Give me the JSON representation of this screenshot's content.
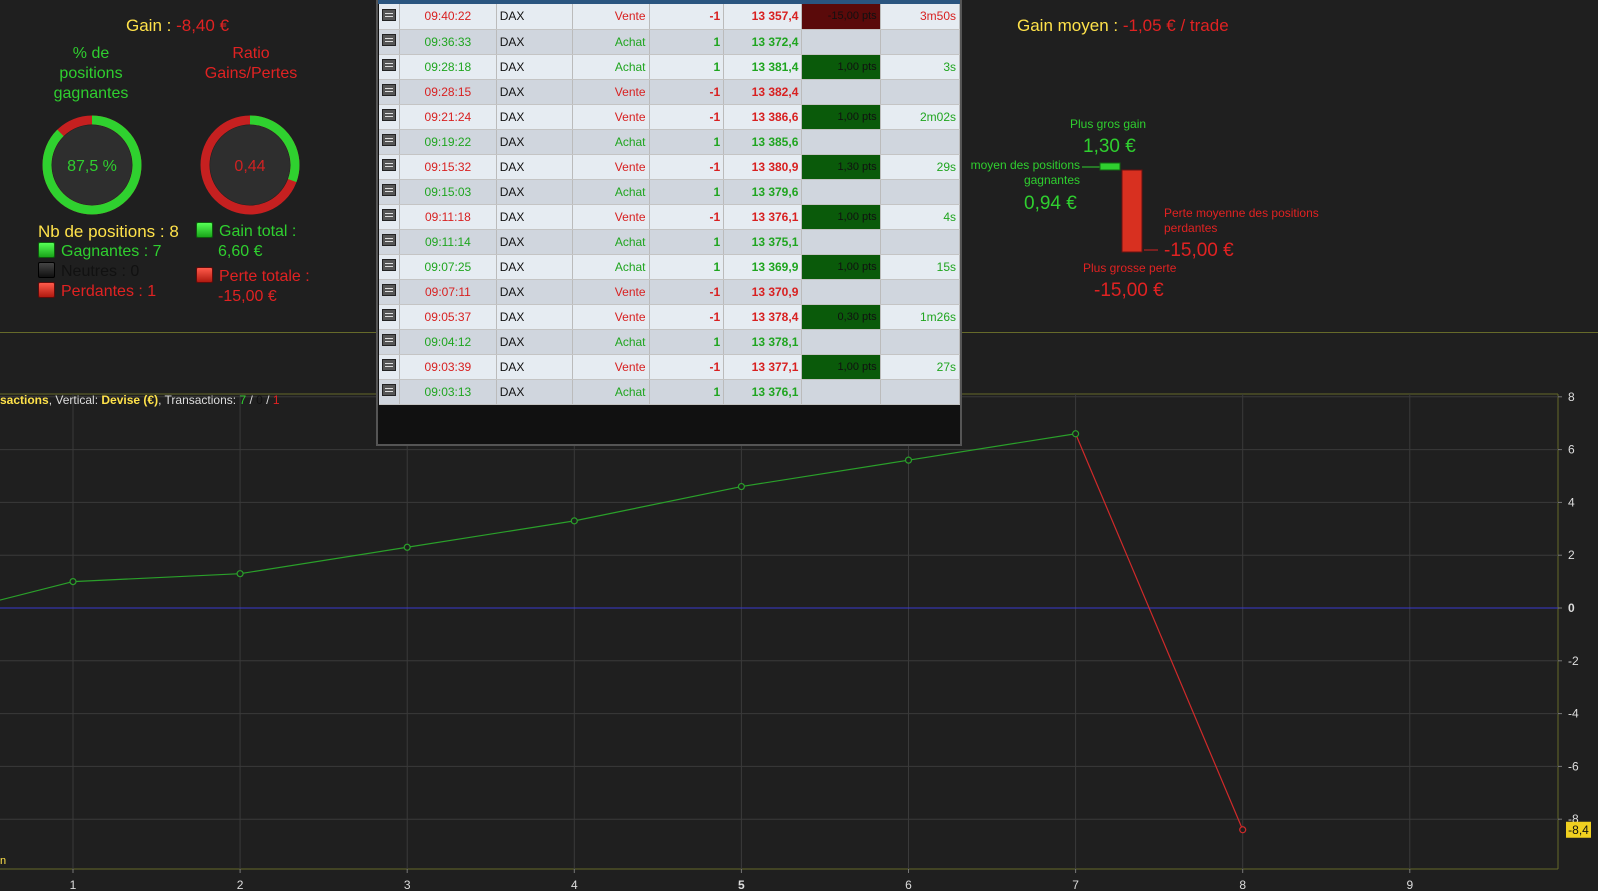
{
  "summary": {
    "gain_label": "Gain : ",
    "gain_value": "-8,40 €",
    "avg_gain_label": "Gain moyen : ",
    "avg_gain_value": "-1,05 € / trade",
    "win_pct_title": "% de positions gagnantes",
    "win_pct_value": "87,5 %",
    "win_pct": 87.5,
    "ratio_title": "Ratio Gains/Pertes",
    "ratio_value": "0,44",
    "ratio_fill": 0.306,
    "nb_positions": "Nb de positions : 8",
    "winners": "Gagnantes : 7",
    "neutral": "Neutres : 0",
    "losers": "Perdantes : 1",
    "total_gain_label": "Gain total :",
    "total_gain_value": "6,60 €",
    "total_loss_label": "Perte totale :",
    "total_loss_value": "-15,00 €"
  },
  "extremes": {
    "biggest_gain_label": "Plus gros gain",
    "biggest_gain_value": "1,30 €",
    "avg_win_label_1": "moyen des positions",
    "avg_win_label_2": "gagnantes",
    "avg_win_value": "0,94 €",
    "avg_loss_label_1": "Perte moyenne des positions",
    "avg_loss_label_2": "perdantes",
    "avg_loss_value": "-15,00 €",
    "biggest_loss_label": "Plus grosse perte",
    "biggest_loss_value": "-15,00 €"
  },
  "trades": [
    {
      "time": "09:40:22",
      "inst": "DAX",
      "side": "Vente",
      "qty": "-1",
      "price": "13 357,4",
      "pts": "-15,00 pts",
      "dur": "3m50s",
      "color": "red",
      "pts_color": "red"
    },
    {
      "time": "09:36:33",
      "inst": "DAX",
      "side": "Achat",
      "qty": "1",
      "price": "13 372,4",
      "pts": "",
      "dur": "",
      "color": "green",
      "pts_color": ""
    },
    {
      "time": "09:28:18",
      "inst": "DAX",
      "side": "Achat",
      "qty": "1",
      "price": "13 381,4",
      "pts": "1,00 pts",
      "dur": "3s",
      "color": "green",
      "pts_color": "green"
    },
    {
      "time": "09:28:15",
      "inst": "DAX",
      "side": "Vente",
      "qty": "-1",
      "price": "13 382,4",
      "pts": "",
      "dur": "",
      "color": "red",
      "pts_color": ""
    },
    {
      "time": "09:21:24",
      "inst": "DAX",
      "side": "Vente",
      "qty": "-1",
      "price": "13 386,6",
      "pts": "1,00 pts",
      "dur": "2m02s",
      "color": "red",
      "pts_color": "green"
    },
    {
      "time": "09:19:22",
      "inst": "DAX",
      "side": "Achat",
      "qty": "1",
      "price": "13 385,6",
      "pts": "",
      "dur": "",
      "color": "green",
      "pts_color": ""
    },
    {
      "time": "09:15:32",
      "inst": "DAX",
      "side": "Vente",
      "qty": "-1",
      "price": "13 380,9",
      "pts": "1,30 pts",
      "dur": "29s",
      "color": "red",
      "pts_color": "green"
    },
    {
      "time": "09:15:03",
      "inst": "DAX",
      "side": "Achat",
      "qty": "1",
      "price": "13 379,6",
      "pts": "",
      "dur": "",
      "color": "green",
      "pts_color": ""
    },
    {
      "time": "09:11:18",
      "inst": "DAX",
      "side": "Vente",
      "qty": "-1",
      "price": "13 376,1",
      "pts": "1,00 pts",
      "dur": "4s",
      "color": "red",
      "pts_color": "green"
    },
    {
      "time": "09:11:14",
      "inst": "DAX",
      "side": "Achat",
      "qty": "1",
      "price": "13 375,1",
      "pts": "",
      "dur": "",
      "color": "green",
      "pts_color": ""
    },
    {
      "time": "09:07:25",
      "inst": "DAX",
      "side": "Achat",
      "qty": "1",
      "price": "13 369,9",
      "pts": "1,00 pts",
      "dur": "15s",
      "color": "green",
      "pts_color": "green"
    },
    {
      "time": "09:07:11",
      "inst": "DAX",
      "side": "Vente",
      "qty": "-1",
      "price": "13 370,9",
      "pts": "",
      "dur": "",
      "color": "red",
      "pts_color": ""
    },
    {
      "time": "09:05:37",
      "inst": "DAX",
      "side": "Vente",
      "qty": "-1",
      "price": "13 378,4",
      "pts": "0,30 pts",
      "dur": "1m26s",
      "color": "red",
      "pts_color": "green"
    },
    {
      "time": "09:04:12",
      "inst": "DAX",
      "side": "Achat",
      "qty": "1",
      "price": "13 378,1",
      "pts": "",
      "dur": "",
      "color": "green",
      "pts_color": ""
    },
    {
      "time": "09:03:39",
      "inst": "DAX",
      "side": "Vente",
      "qty": "-1",
      "price": "13 377,1",
      "pts": "1,00 pts",
      "dur": "27s",
      "color": "red",
      "pts_color": "green"
    },
    {
      "time": "09:03:13",
      "inst": "DAX",
      "side": "Achat",
      "qty": "1",
      "price": "13 376,1",
      "pts": "",
      "dur": "",
      "color": "green",
      "pts_color": ""
    }
  ],
  "chart_caption": {
    "part1": "sactions",
    "part2": ", Vertical: ",
    "part3": "Devise (€)",
    "part4": ", Transactions: ",
    "t1": "7",
    "sep1": " / ",
    "t2": "0",
    "sep2": " / ",
    "t3": "1",
    "corner": "n"
  },
  "chart_data": {
    "type": "line",
    "x": [
      0,
      1,
      2,
      3,
      4,
      5,
      6,
      7,
      8
    ],
    "y": [
      0.3,
      1.0,
      1.3,
      2.3,
      3.3,
      4.6,
      5.6,
      6.6,
      -8.4
    ],
    "xticks": [
      "1",
      "2",
      "3",
      "4",
      "5",
      "6",
      "7",
      "8",
      "9"
    ],
    "yticks": [
      "8",
      "6",
      "4",
      "2",
      "0",
      "-2",
      "-4",
      "-6",
      "-8"
    ],
    "ylim": [
      -9.9,
      7.9
    ],
    "xlim": [
      0.56,
      9.9
    ],
    "last_value_label": "-8,4",
    "grid": true,
    "colors": {
      "up": "#2aa02a",
      "down": "#d02a2a",
      "zero": "#3a3acc"
    }
  }
}
